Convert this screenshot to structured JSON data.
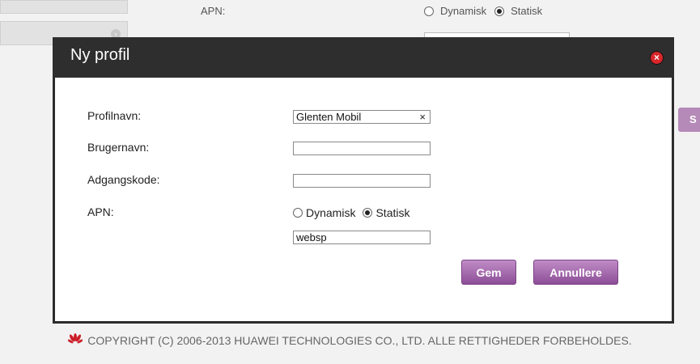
{
  "background": {
    "apn_label": "APN:",
    "apn_dynamic": "Dynamisk",
    "apn_static": "Statisk",
    "side_button": "S"
  },
  "dialog": {
    "title": "Ny profil",
    "fields": {
      "profile_name_label": "Profilnavn:",
      "profile_name_value": "Glenten Mobil",
      "username_label": "Brugernavn:",
      "username_value": "",
      "password_label": "Adgangskode:",
      "password_value": "",
      "apn_label": "APN:",
      "apn_dynamic": "Dynamisk",
      "apn_static": "Statisk",
      "apn_selected": "Statisk",
      "apn_value": "websp"
    },
    "buttons": {
      "save": "Gem",
      "cancel": "Annullere"
    },
    "close_icon": "close-icon",
    "clear_icon": "×"
  },
  "footer": {
    "copyright": "COPYRIGHT (C) 2006-2013 HUAWEI TECHNOLOGIES CO., LTD. ALLE RETTIGHEDER FORBEHOLDES.",
    "logo_icon": "huawei-logo-icon"
  },
  "colors": {
    "button_accent": "#9b5fa5",
    "dialog_header": "#2e2e2e",
    "close_red": "#d9262b",
    "logo_red": "#cc1f2a"
  }
}
